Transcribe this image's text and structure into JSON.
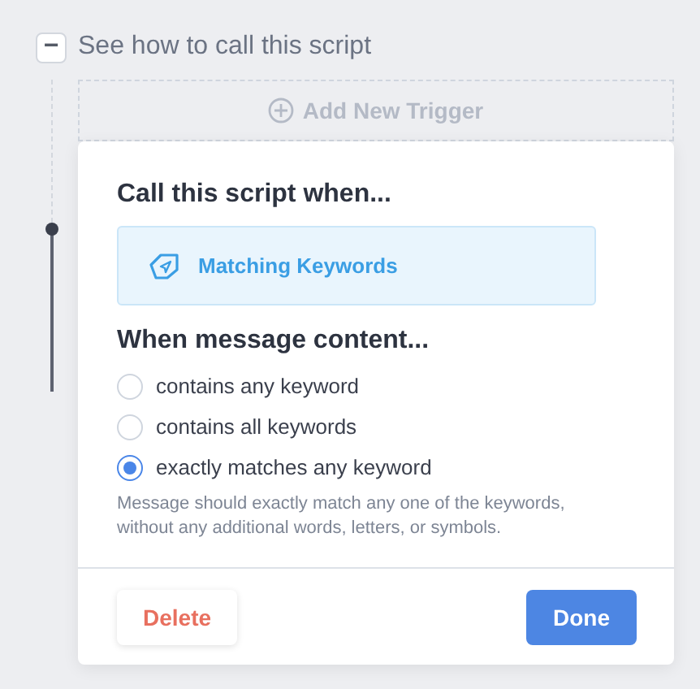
{
  "section": {
    "expanded": true,
    "toggle_symbol": "−",
    "title": "See how to call this script"
  },
  "add_trigger": {
    "label": "Add New Trigger"
  },
  "popup": {
    "title": "Call this script when...",
    "trigger": {
      "label": "Matching Keywords"
    },
    "heading": "When message content...",
    "options": [
      {
        "label": "contains any keyword",
        "selected": false
      },
      {
        "label": "contains all keywords",
        "selected": false
      },
      {
        "label": "exactly matches any keyword",
        "selected": true
      }
    ],
    "help": "Message should exactly match any one of the keywords, without any additional words, letters, or symbols.",
    "buttons": [
      {
        "kind": "delete",
        "label": "Delete"
      },
      {
        "kind": "done",
        "label": "Done"
      }
    ]
  }
}
